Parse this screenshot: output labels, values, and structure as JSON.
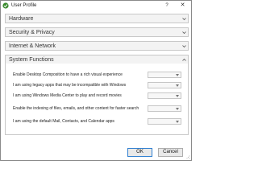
{
  "window": {
    "title": "User Profile",
    "help_label": "?",
    "close_label": "✕"
  },
  "sections": [
    {
      "label": "Hardware",
      "expanded": false
    },
    {
      "label": "Security & Privacy",
      "expanded": false
    },
    {
      "label": "Internet & Network",
      "expanded": false
    },
    {
      "label": "System Functions",
      "expanded": true
    }
  ],
  "settings": [
    {
      "label": "Enable Desktop Composition to have a rich visual experience",
      "value": ""
    },
    {
      "label": "I am using legacy apps that may be incompatible with Windows",
      "value": ""
    },
    {
      "label": "I am using Windows Media Center to play and record movies",
      "value": ""
    },
    {
      "label": "Enable the indexing of files, emails, and other content for faster search",
      "value": ""
    },
    {
      "label": "I am using the default Mail, Contacts, and Calendar apps",
      "value": ""
    }
  ],
  "footer": {
    "ok_label": "OK",
    "cancel_label": "Cancel"
  },
  "colors": {
    "accent": "#2f7fd1",
    "app_icon": "#3a8a2e",
    "section_bg": "#f3f3f3"
  }
}
